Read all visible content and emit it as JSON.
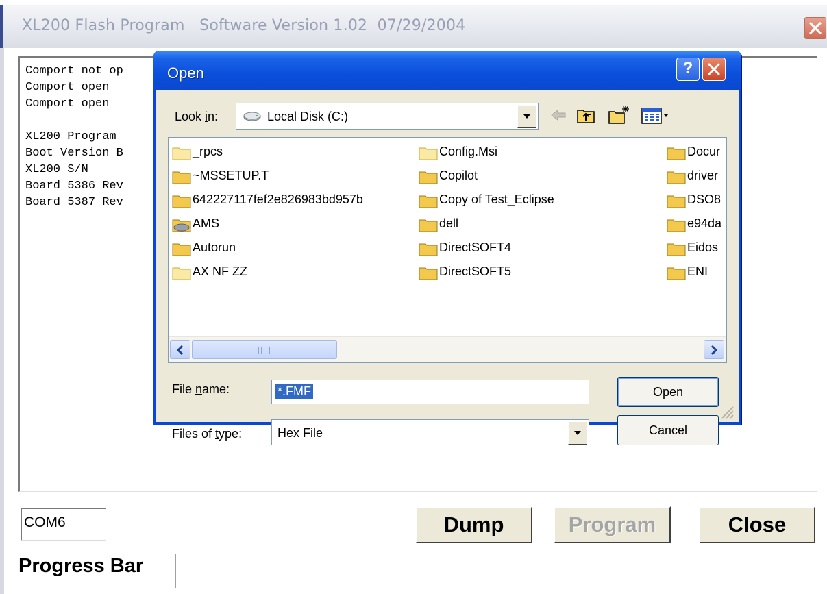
{
  "main_window": {
    "title": "XL200 Flash Program   Software Version 1.02  07/29/2004",
    "log_lines": [
      "Comport not op",
      "Comport open",
      "Comport open",
      "",
      "XL200 Program",
      "Boot Version B",
      "XL200 S/N",
      "Board 5386 Rev",
      "Board 5387 Rev"
    ],
    "com_port": "COM6",
    "buttons": {
      "dump": "Dump",
      "program": "Program",
      "close": "Close"
    },
    "program_enabled": false,
    "progress_label": "Progress Bar"
  },
  "open_dialog": {
    "title": "Open",
    "help_label": "?",
    "look_in": {
      "label_pre": "Look ",
      "label_accel": "i",
      "label_post": "n:",
      "value": "Local Disk (C:)"
    },
    "toolbar_icons": [
      "back-icon",
      "up-folder-icon",
      "new-folder-icon",
      "view-menu-icon"
    ],
    "files": {
      "col1": [
        "_rpcs",
        "~MSSETUP.T",
        "642227117fef2e826983bd957b",
        "AMS",
        "Autorun",
        "AX NF ZZ"
      ],
      "col2": [
        "Config.Msi",
        "Copilot",
        "Copy of Test_Eclipse",
        "dell",
        "DirectSOFT4",
        "DirectSOFT5"
      ],
      "col3": [
        "Docur",
        "driver",
        "DSO8",
        "e94da",
        "Eidos",
        "ENI"
      ]
    },
    "file_name": {
      "label_pre": "File ",
      "label_accel": "n",
      "label_post": "ame:",
      "value": "*.FMF"
    },
    "files_of_type": {
      "label_pre": "Files of ",
      "label_accel": "t",
      "label_post": "ype:",
      "value": "Hex File"
    },
    "open_button": {
      "accel": "O",
      "rest": "pen"
    },
    "cancel_button": "Cancel"
  },
  "colors": {
    "dialog_titlebar": "#0a46d8",
    "dialog_body": "#ece9d8",
    "selection": "#316ac5",
    "folder": "#f2c94c"
  }
}
